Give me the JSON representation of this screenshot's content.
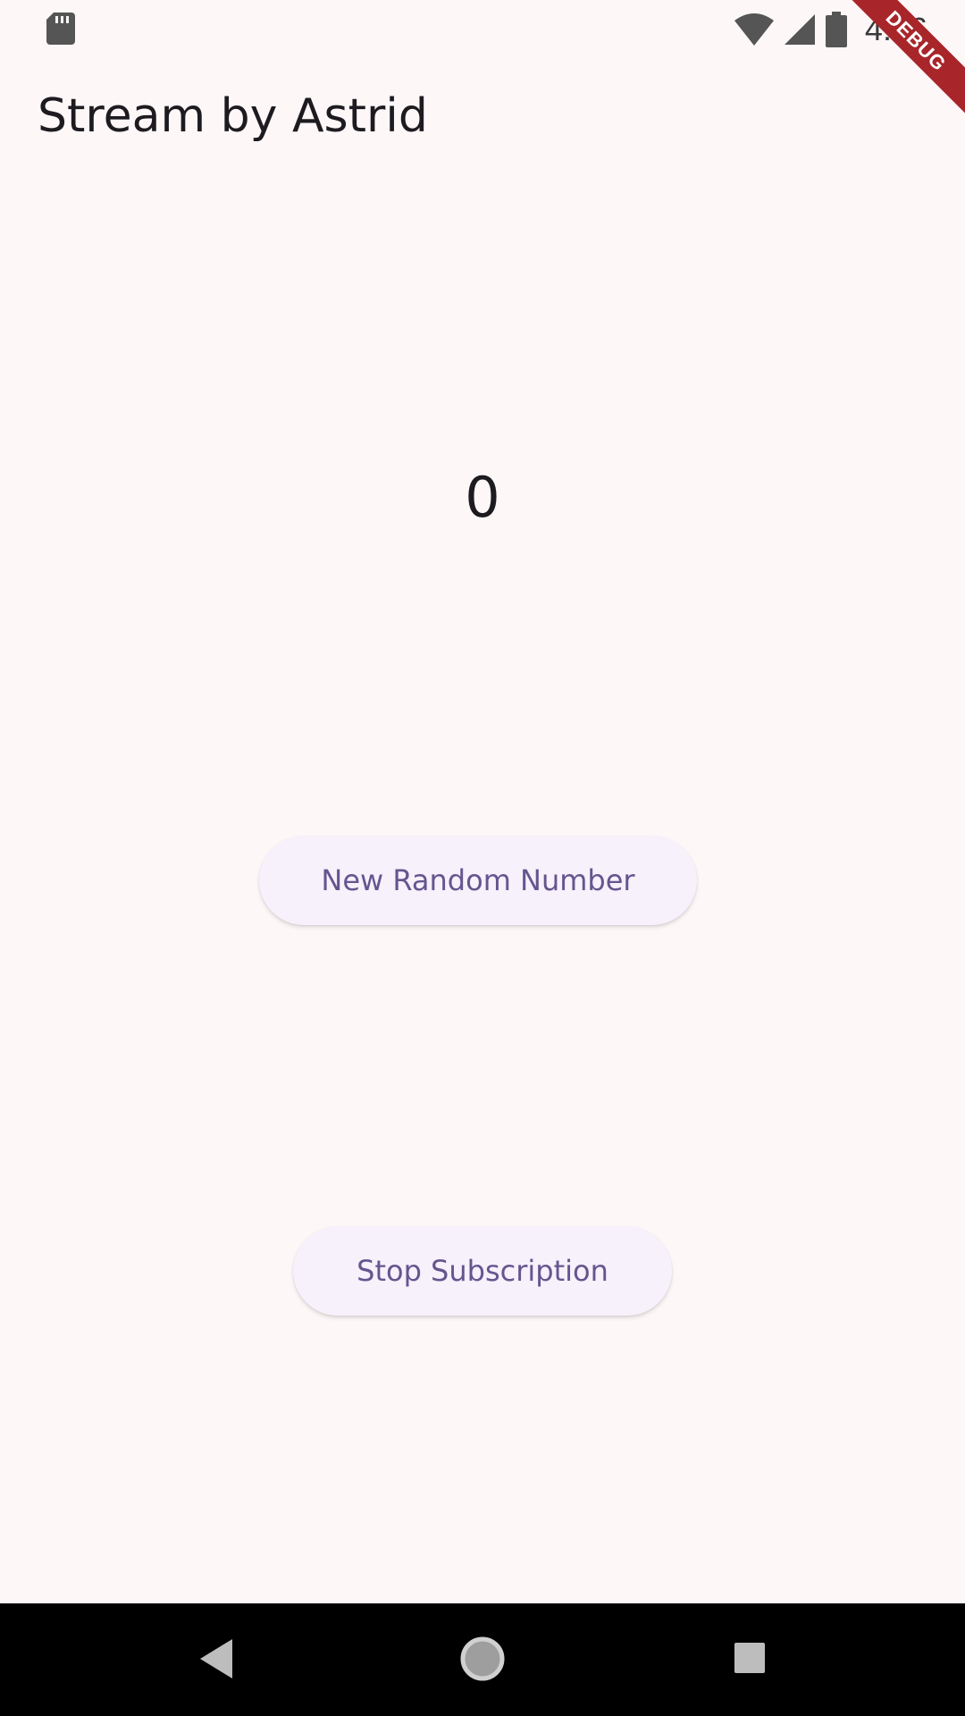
{
  "status_bar": {
    "time": "4:16",
    "icons": [
      "sd-card-icon",
      "wifi-icon",
      "cell-signal-icon",
      "battery-icon"
    ]
  },
  "debug_banner": {
    "label": "DEBUG",
    "color": "#a8262a"
  },
  "app_bar": {
    "title": "Stream by Astrid"
  },
  "main": {
    "number": "0",
    "random_button_label": "New Random Number",
    "stop_button_label": "Stop Subscription"
  },
  "nav_bar": {
    "icons": [
      "back-icon",
      "home-icon",
      "recent-apps-icon"
    ]
  },
  "colors": {
    "background": "#fdf7f8",
    "button_text": "#65558f",
    "button_bg": "#f6f1fa",
    "nav_bar": "#000000"
  }
}
